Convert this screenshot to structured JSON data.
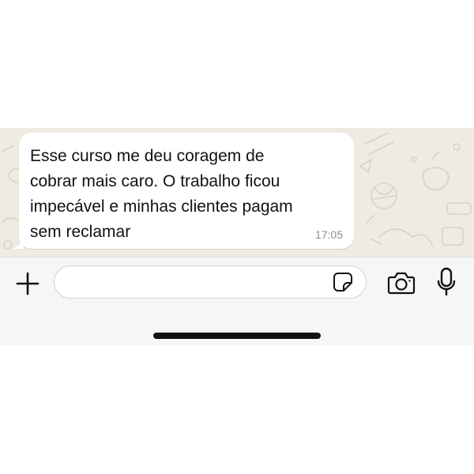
{
  "colors": {
    "chat_background": "#efeae2",
    "bubble_background": "#ffffff",
    "input_bar_background": "#f6f6f6",
    "timestamp": "#8c8c8c",
    "icon": "#111111"
  },
  "message": {
    "lines": [
      "Esse curso me deu coragem de",
      "cobrar mais caro. O trabalho ficou",
      "impecável e minhas clientes pagam",
      "sem reclamar"
    ],
    "time": "17:05"
  },
  "input_bar": {
    "message_value": "",
    "icons": {
      "attach": "plus-icon",
      "sticker": "sticker-icon",
      "camera": "camera-icon",
      "voice": "microphone-icon"
    }
  }
}
